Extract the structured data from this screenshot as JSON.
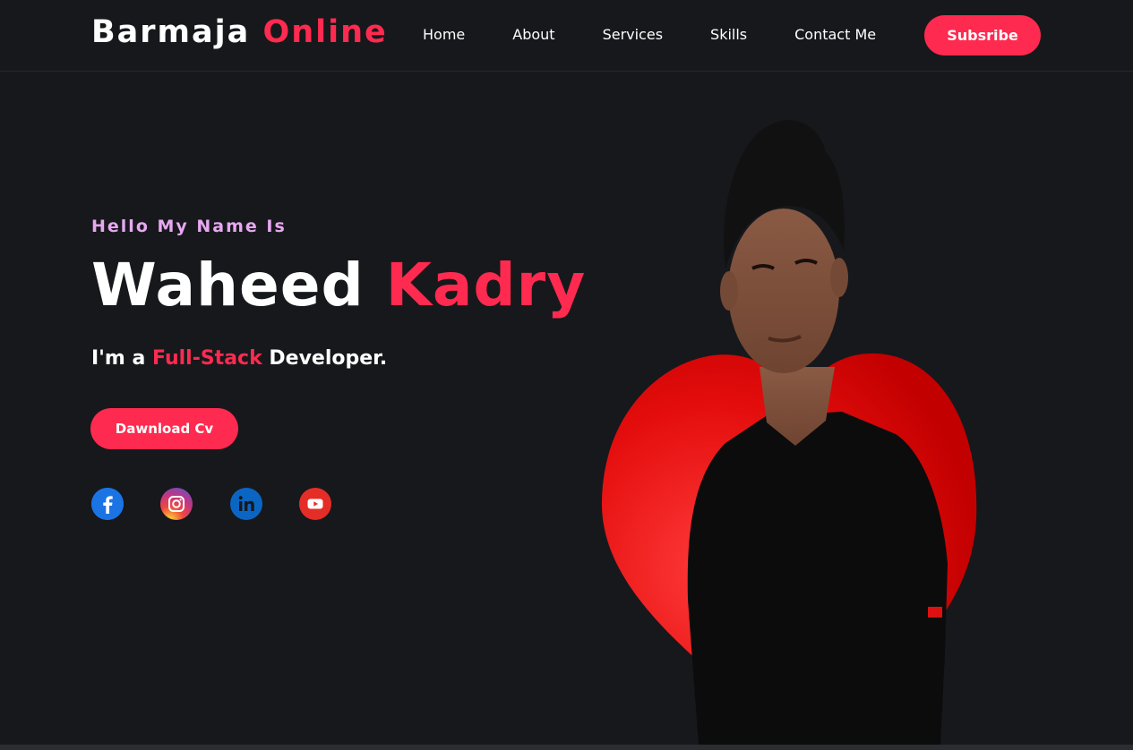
{
  "header": {
    "logo_main": "Barmaja",
    "logo_accent": "Online",
    "nav": [
      {
        "label": "Home"
      },
      {
        "label": "About"
      },
      {
        "label": "Services"
      },
      {
        "label": "Skills"
      },
      {
        "label": "Contact Me"
      }
    ],
    "subscribe_label": "Subsribe"
  },
  "hero": {
    "greeting": "Hello My Name Is",
    "first_name": "Waheed",
    "last_name": "Kadry",
    "role_prefix": "I'm a",
    "role_highlight": "Full-Stack",
    "role_suffix": "Developer.",
    "cv_button": "Dawnload Cv",
    "socials": [
      {
        "icon": "facebook-icon",
        "color": "#1877f2"
      },
      {
        "icon": "instagram-icon",
        "color": "#c13584"
      },
      {
        "icon": "linkedin-icon",
        "color": "#0a66c2"
      },
      {
        "icon": "youtube-icon",
        "color": "#ff0000"
      }
    ]
  },
  "colors": {
    "accent": "#ff2a4f",
    "background": "#17181c",
    "greeting": "#e7a8f0"
  }
}
